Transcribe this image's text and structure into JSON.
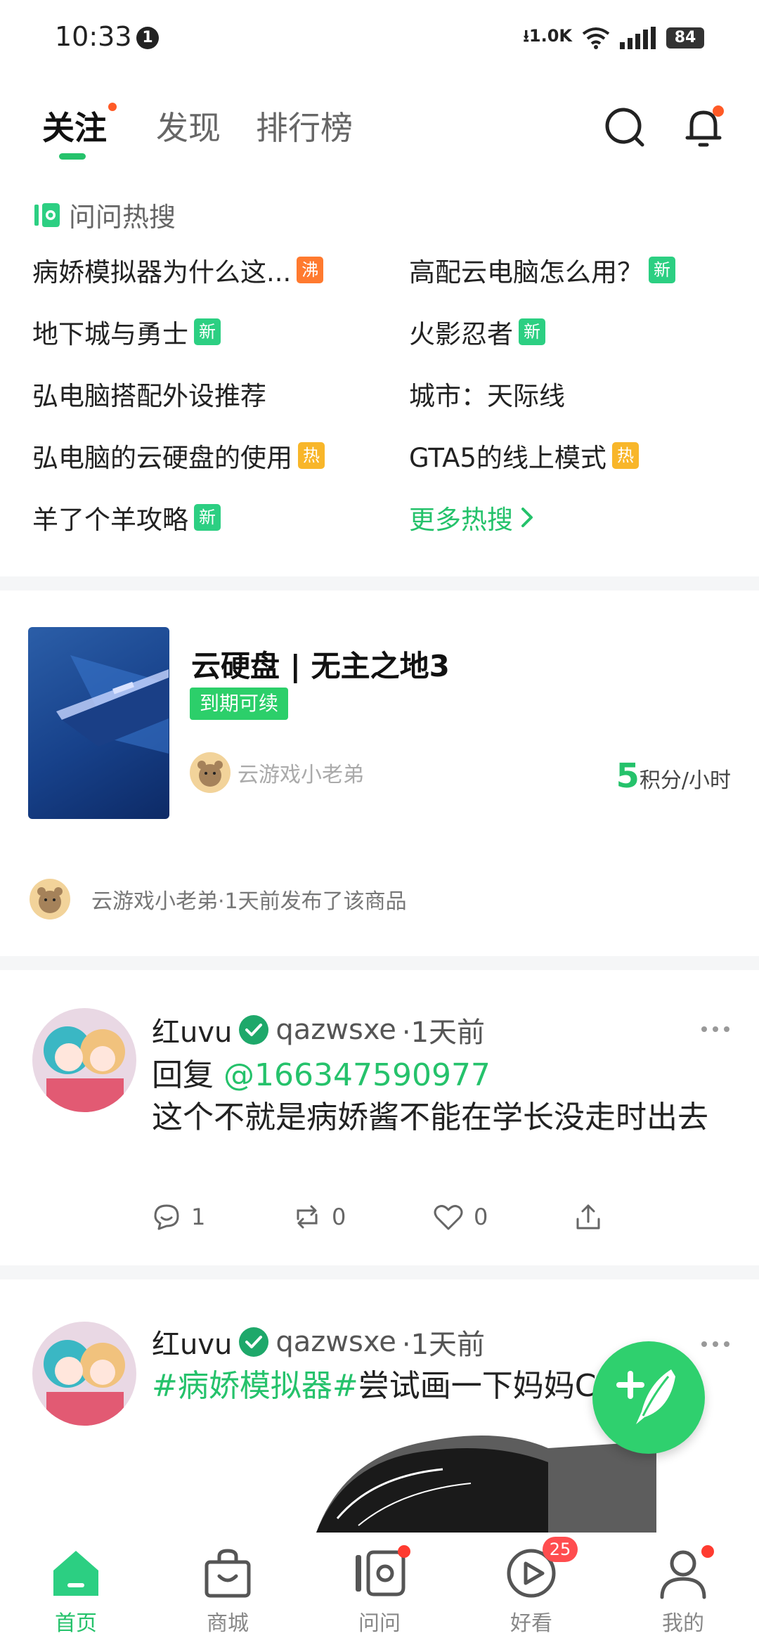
{
  "status_bar": {
    "time": "10:33",
    "notification_count": "1",
    "net_speed": "1.0K",
    "battery": "84"
  },
  "top_tabs": [
    {
      "label": "关注",
      "active": true,
      "dot": true
    },
    {
      "label": "发现",
      "active": false
    },
    {
      "label": "排行榜",
      "active": false
    }
  ],
  "hot_search": {
    "title": "问问热搜",
    "items": [
      {
        "text": "病娇模拟器为什么这...",
        "badge": "沸",
        "badge_type": "boil"
      },
      {
        "text": "高配云电脑怎么用？",
        "badge": "新",
        "badge_type": "new"
      },
      {
        "text": "地下城与勇士",
        "badge": "新",
        "badge_type": "new"
      },
      {
        "text": "火影忍者",
        "badge": "新",
        "badge_type": "new"
      },
      {
        "text": "弘电脑搭配外设推荐",
        "badge": "",
        "badge_type": ""
      },
      {
        "text": "城市：天际线",
        "badge": "",
        "badge_type": ""
      },
      {
        "text": "弘电脑的云硬盘的使用",
        "badge": "热",
        "badge_type": "hot"
      },
      {
        "text": "GTA5的线上模式",
        "badge": "热",
        "badge_type": "hot"
      },
      {
        "text": "羊了个羊攻略",
        "badge": "新",
        "badge_type": "new"
      }
    ],
    "more_label": "更多热搜"
  },
  "product": {
    "title": "云硬盘 | 无主之地3",
    "tag": "到期可续",
    "seller": "云游戏小老弟",
    "price_value": "5",
    "price_unit": "积分/小时",
    "published_text": "云游戏小老弟·1天前发布了该商品"
  },
  "posts": [
    {
      "user": "红uvu",
      "handle": "qazwsxe",
      "time": "·1天前",
      "reply_prefix": "回复 ",
      "reply_mention": "@166347590977",
      "body": "这个不就是病娇酱不能在学长没走时出去",
      "comments": "1",
      "reposts": "0",
      "likes": "0"
    },
    {
      "user": "红uvu",
      "handle": "qazwsxe",
      "time": "·1天前",
      "hashtag": "#病娇模拟器#",
      "body": "尝试画一下妈妈C"
    }
  ],
  "bottom_nav": [
    {
      "label": "首页",
      "active": true
    },
    {
      "label": "商城",
      "active": false
    },
    {
      "label": "问问",
      "active": false,
      "dot": true
    },
    {
      "label": "好看",
      "active": false,
      "count": "25"
    },
    {
      "label": "我的",
      "active": false,
      "dot": true
    }
  ],
  "colors": {
    "accent": "#25c26b",
    "badge_new": "#2ccf82",
    "badge_hot": "#f8b62a",
    "badge_boil": "#ff7a2f",
    "dot": "#ff5a26"
  }
}
